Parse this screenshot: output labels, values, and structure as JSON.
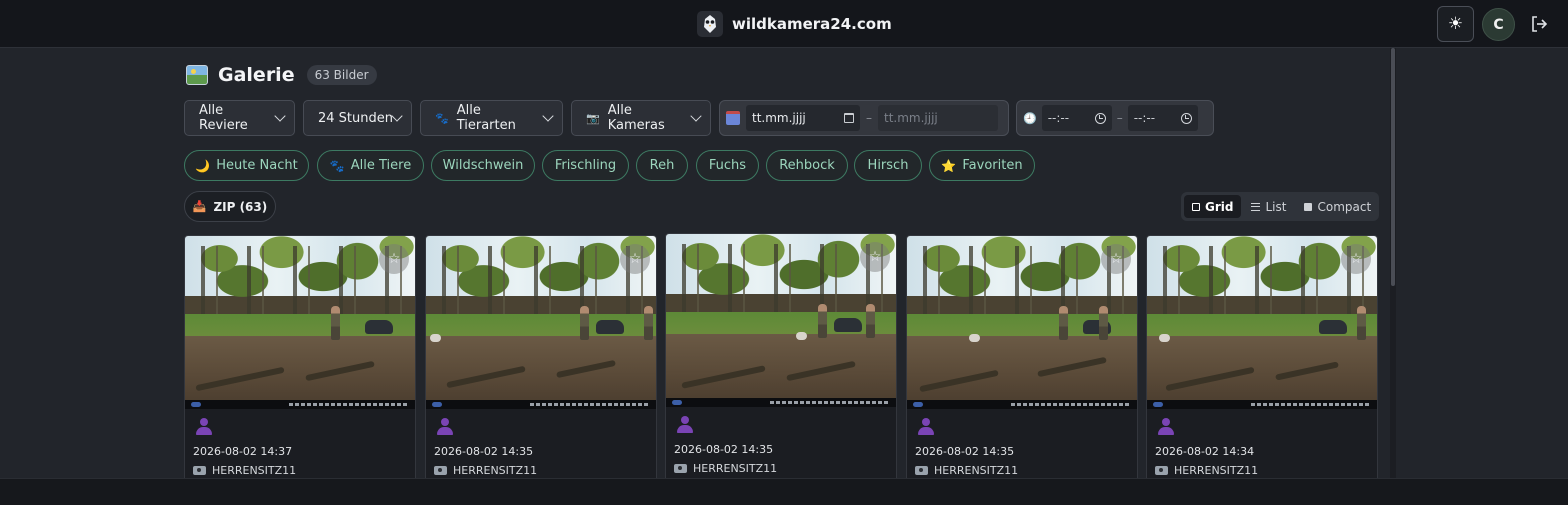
{
  "header": {
    "brand": "wildkamera24.com",
    "avatar_initial": "C",
    "theme_icon": "sun-icon",
    "logout_icon": "logout-icon"
  },
  "page": {
    "title": "Galerie",
    "count_badge": "63 Bilder"
  },
  "filters": {
    "revier": "Alle Reviere",
    "timespan": "24 Stunden",
    "species": "Alle Tierarten",
    "cameras": "Alle Kameras",
    "date_from_placeholder": "tt.mm.jjjj",
    "date_to_placeholder": "tt.mm.jjjj",
    "time_from_placeholder": "--:--",
    "time_to_placeholder": "--:--",
    "range_separator": "–"
  },
  "chips": [
    {
      "label": "Heute Nacht",
      "icon": "🌙"
    },
    {
      "label": "Alle Tiere",
      "icon": "🐾"
    },
    {
      "label": "Wildschwein"
    },
    {
      "label": "Frischling"
    },
    {
      "label": "Reh"
    },
    {
      "label": "Fuchs"
    },
    {
      "label": "Rehbock"
    },
    {
      "label": "Hirsch"
    },
    {
      "label": "Favoriten",
      "icon": "⭐"
    }
  ],
  "toolbar": {
    "zip_label": "ZIP (63)",
    "views": [
      "Grid",
      "List",
      "Compact"
    ],
    "active_view": "Grid"
  },
  "cards": [
    {
      "datetime": "2026-08-02 14:37",
      "camera": "HERRENSITZ11"
    },
    {
      "datetime": "2026-08-02 14:35",
      "camera": "HERRENSITZ11"
    },
    {
      "datetime": "2026-08-02 14:35",
      "camera": "HERRENSITZ11"
    },
    {
      "datetime": "2026-08-02 14:35",
      "camera": "HERRENSITZ11"
    },
    {
      "datetime": "2026-08-02 14:34",
      "camera": "HERRENSITZ11"
    }
  ],
  "colors": {
    "accent_chip": "#9cd6bd",
    "chip_border": "#3d7a62",
    "background": "#22252b",
    "topbar": "#14161b"
  }
}
